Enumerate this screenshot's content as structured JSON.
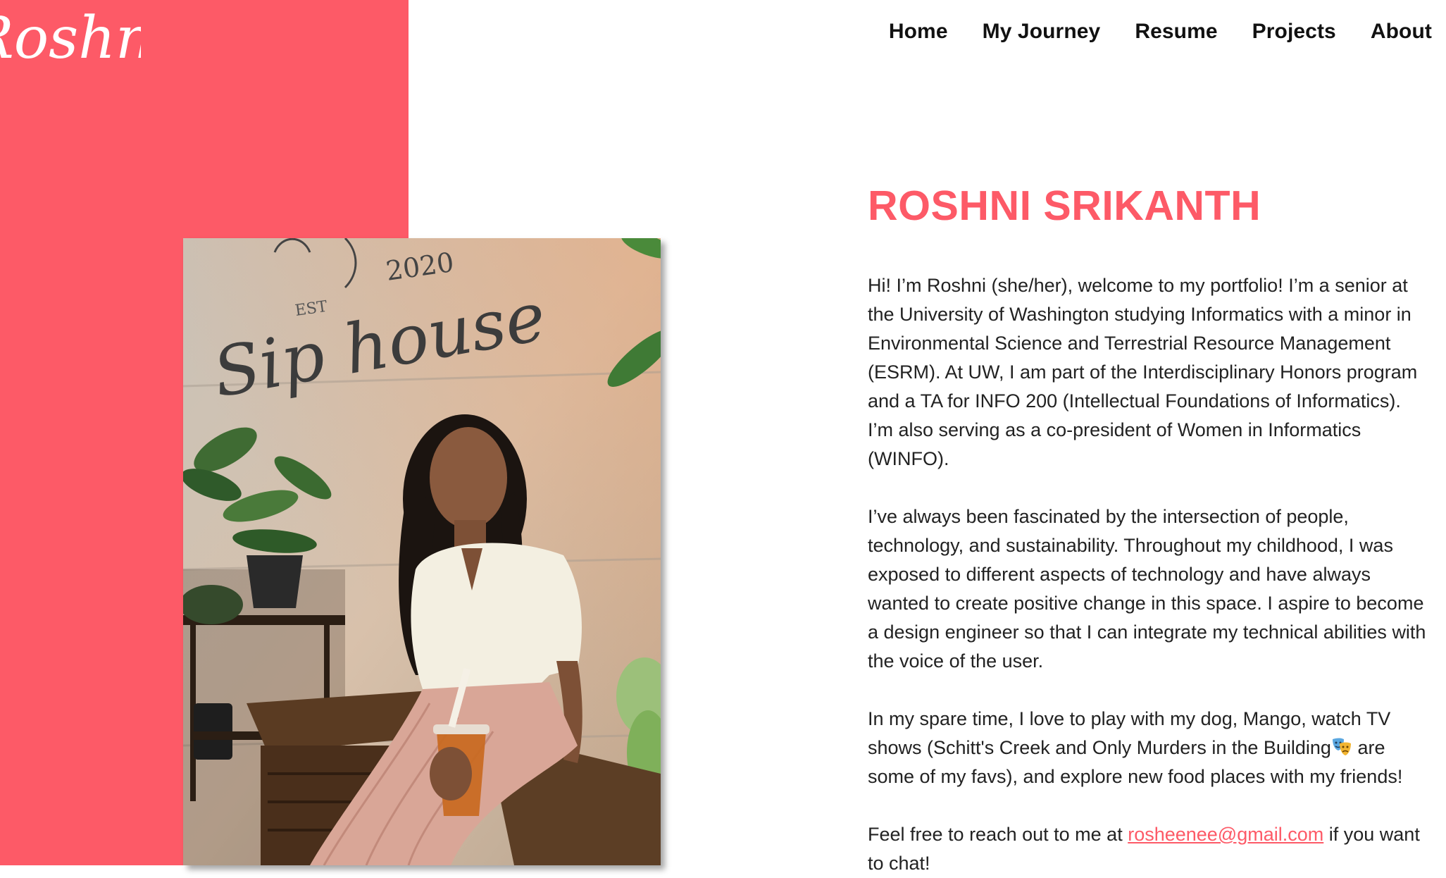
{
  "brand": {
    "logo_text": "Roshni",
    "accent_color": "#fd5a67"
  },
  "nav": {
    "items": [
      {
        "label": "Home"
      },
      {
        "label": "My Journey"
      },
      {
        "label": "Resume"
      },
      {
        "label": "Projects"
      },
      {
        "label": "About"
      }
    ]
  },
  "photo": {
    "sign_year": "2020",
    "sign_est": "EST",
    "sign_script": "Sip house"
  },
  "about": {
    "name": "ROSHNI SRIKANTH",
    "paragraph_1": "Hi! I’m Roshni (she/her), welcome to my portfolio! I’m a senior at the University of Washington studying Informatics with a minor in Environmental Science and Terrestrial Resource Management (ESRM). At UW, I am part of the Interdisciplinary Honors program and a TA for INFO 200 (Intellectual Foundations of Informatics). I’m also serving as a co-president of Women in Informatics (WINFO).",
    "paragraph_2": "I’ve always been fascinated by the intersection of people, technology, and sustainability. Throughout my childhood, I was exposed to different aspects of technology and have always wanted to create positive change in this space. I aspire to become a design engineer so that I can integrate my technical abilities with the voice of the user.",
    "paragraph_3_before": "In my spare time, I love to play with my dog, Mango, watch TV shows (Schitt's Creek and Only Murders in the Building",
    "paragraph_3_icon": "performing-arts-masks-icon",
    "paragraph_3_after": " are some of my favs), and explore new food places with my friends!",
    "contact_before": "Feel free to reach out to me at ",
    "contact_email": "rosheenee@gmail.com",
    "contact_after": " if you want to chat!"
  }
}
